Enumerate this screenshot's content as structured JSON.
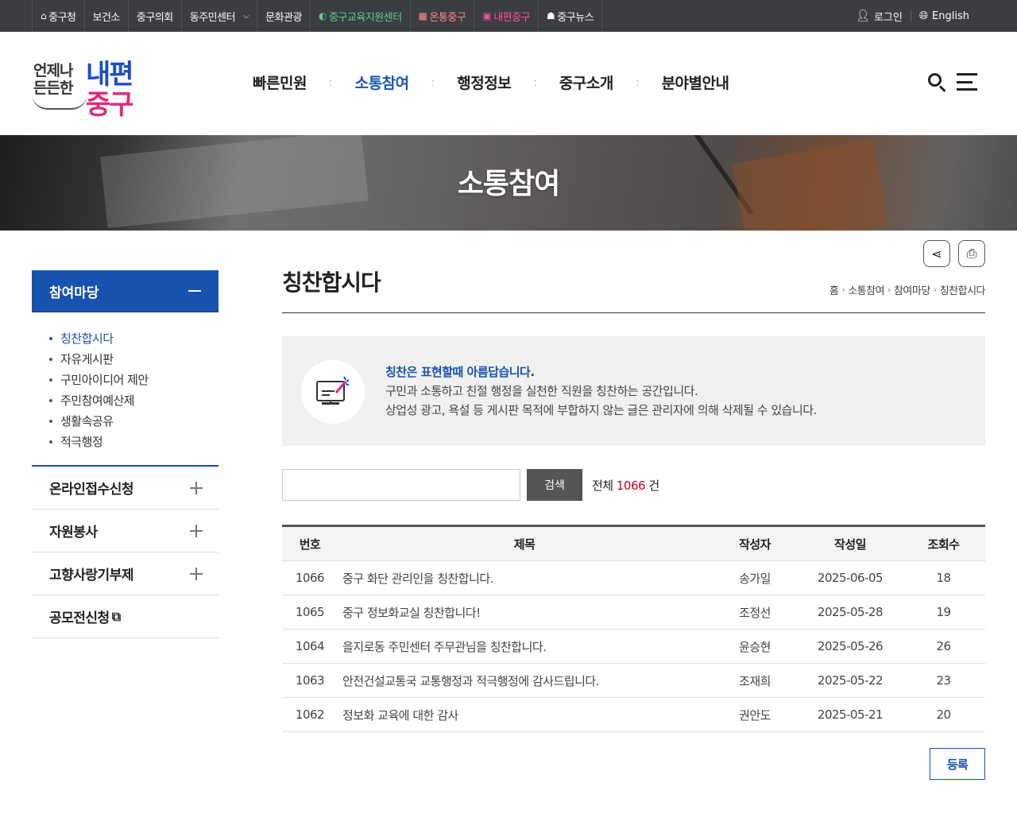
{
  "topbar": {
    "links": [
      {
        "label": "중구청",
        "icon": "home-icon",
        "glyph": "⌂"
      },
      {
        "label": "보건소"
      },
      {
        "label": "중구의회"
      },
      {
        "label": "동주민센터",
        "dropdown": true
      },
      {
        "label": "문화관광"
      },
      {
        "label": "중구교육지원센터",
        "icon": "education-center-logo-icon",
        "glyph": "◐",
        "color": "#5fd38a"
      },
      {
        "label": "온통중구",
        "icon": "ontong-logo-icon",
        "glyph": "▦",
        "color": "#ff8a8a"
      },
      {
        "label": "내편중구",
        "icon": "naepyeon-logo-icon",
        "glyph": "▣",
        "color": "#ff4fa0"
      },
      {
        "label": "중구뉴스",
        "icon": "news-logo-icon",
        "glyph": "☗"
      }
    ],
    "login_label": "로그인",
    "english_label": "English"
  },
  "logo": {
    "slogan": "언제나 든든한",
    "brand_top": "내편",
    "brand_bottom": "중구"
  },
  "gnb": {
    "items": [
      "빠른민원",
      "소통참여",
      "행정정보",
      "중구소개",
      "분야별안내"
    ],
    "active_index": 1
  },
  "banner": {
    "title": "소통참여"
  },
  "lnb": {
    "head": "참여마당",
    "subs": [
      "칭찬합시다",
      "자유게시판",
      "구민아이디어 제안",
      "주민참여예산제",
      "생활속공유",
      "적극행정"
    ],
    "active_sub": 0,
    "groups": [
      "온라인접수신청",
      "자원봉사",
      "고향사랑기부제"
    ],
    "external": "공모전신청"
  },
  "page": {
    "title": "칭찬합시다",
    "breadcrumb": [
      "홈",
      "소통참여",
      "참여마당",
      "칭찬합시다"
    ]
  },
  "notice": {
    "lead": "칭찬은 표현할때 아름답습니다.",
    "line1": "구민과 소통하고 친절 행정을 실천한 직원을 칭찬하는 공간입니다.",
    "line2": "상업성 광고, 욕설 등 게시판 목적에 부합하지 않는 글은 관리자에 의해 삭제될 수 있습니다."
  },
  "search": {
    "value": "",
    "button": "검색",
    "total_prefix": "전체",
    "total_count": "1066",
    "total_suffix": "건"
  },
  "table": {
    "headers": [
      "번호",
      "제목",
      "작성자",
      "작성일",
      "조회수"
    ],
    "rows": [
      [
        "1066",
        "중구 화단 관리인을 칭찬합니다.",
        "송가일",
        "2025-06-05",
        "18"
      ],
      [
        "1065",
        "중구 정보화교실 칭찬합니다!",
        "조정선",
        "2025-05-28",
        "19"
      ],
      [
        "1064",
        "을지로동 주민센터 주무관님을 칭찬합니다.",
        "윤승현",
        "2025-05-26",
        "26"
      ],
      [
        "1063",
        "안전건설교통국 교통행정과 적극행정에 감사드립니다.",
        "조재희",
        "2025-05-22",
        "23"
      ],
      [
        "1062",
        "정보화 교육에 대한 감사",
        "권안도",
        "2025-05-21",
        "20"
      ]
    ]
  },
  "register_button": "등록",
  "colors": {
    "primary": "#1752b0",
    "topbar": "#3a3d42",
    "count": "#d0021b",
    "brand_pink": "#e4287d"
  }
}
